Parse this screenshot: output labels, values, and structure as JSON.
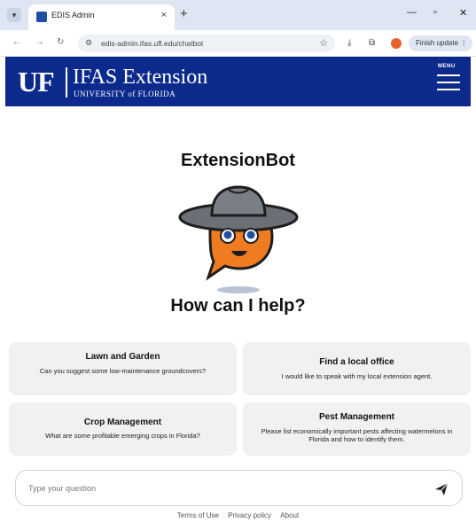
{
  "browser": {
    "tab_title": "EDIS Admin",
    "tab_close": "×",
    "new_tab": "+",
    "url": "edis-admin.ifas.ufl.edu/chatbot",
    "finish_update_label": "Finish update"
  },
  "header": {
    "logo_text": "UF",
    "title": "IFAS Extension",
    "subtitle": "UNIVERSITY of FLORIDA",
    "menu_label": "MENU"
  },
  "main": {
    "bot_name": "ExtensionBot",
    "help_heading": "How can I help?",
    "cards": [
      {
        "title": "Lawn and Garden",
        "desc": "Can you suggest some low-maintenance groundcovers?"
      },
      {
        "title": "Find a local office",
        "desc": "I would like to speak with my local extension agent."
      },
      {
        "title": "Crop Management",
        "desc": "What are some profitable emerging crops in Florida?"
      },
      {
        "title": "Pest Management",
        "desc": "Please list economically important pests affecting watermelons in Florida and how to identify them."
      }
    ]
  },
  "chat": {
    "placeholder": "Type your question",
    "value": ""
  },
  "footer": {
    "links": [
      "Terms of Use",
      "Privacy policy",
      "About"
    ]
  },
  "colors": {
    "brand_blue": "#0b2a8c",
    "mascot_orange": "#f07c22",
    "hat_gray": "#6b6f76",
    "card_bg": "#f0f1f3"
  },
  "icons": [
    "tab-menu-icon",
    "favicon-icon",
    "close-icon",
    "back-icon",
    "forward-icon",
    "reload-icon",
    "site-info-icon",
    "star-icon",
    "download-icon",
    "extensions-icon",
    "profile-icon",
    "menu-icon",
    "send-icon"
  ]
}
